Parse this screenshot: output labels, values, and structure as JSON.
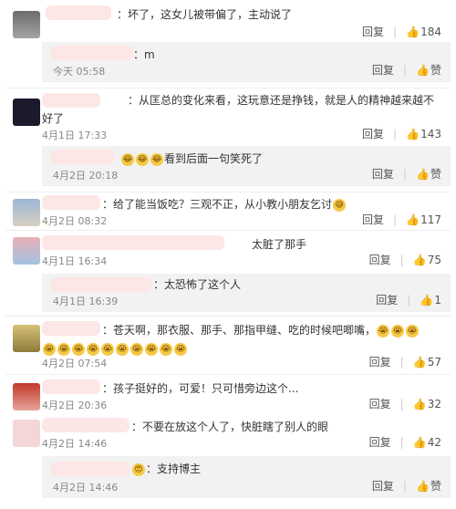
{
  "actions": {
    "reply": "回复",
    "like_icon": "thumb-up-icon"
  },
  "comments": [
    {
      "text": "：坏了，这女儿被带偏了，主动说了",
      "likes": "184"
    },
    {
      "text": "：m",
      "date": "今天 05:58",
      "likes": "赞",
      "reply": true
    },
    {
      "text": "：从匡总的变化来看，这玩意还是挣钱，就是人的精神越来越不好了",
      "date": "4月1日 17:33",
      "likes": "143"
    },
    {
      "text": "看到后面一句笑死了",
      "date": "4月2日 20:18",
      "likes": "赞",
      "reply": true
    },
    {
      "text": "：给了能当饭吃？三观不正，从小教小朋友乞讨",
      "date": "4月2日 08:32",
      "likes": "117"
    },
    {
      "text": "太脏了那手",
      "date": "4月1日 16:34",
      "likes": "75"
    },
    {
      "text": "：太恐怖了这个人",
      "date": "4月1日 16:39",
      "likes": "1",
      "reply": true
    },
    {
      "text": "：苍天啊，那衣服、那手、那指甲缝、吃的时候吧唧嘴，",
      "date": "4月2日 07:54",
      "likes": "57"
    },
    {
      "text": "：孩子挺好的，可爱！只可惜旁边这个...",
      "date": "4月2日 20:36",
      "likes": "32"
    },
    {
      "text": "：不要在放这个人了，快脏瞎了别人的眼",
      "date": "4月2日 14:46",
      "likes": "42"
    },
    {
      "text": "：支持博主",
      "date": "4月2日 14:46",
      "likes": "赞",
      "reply": true
    }
  ]
}
